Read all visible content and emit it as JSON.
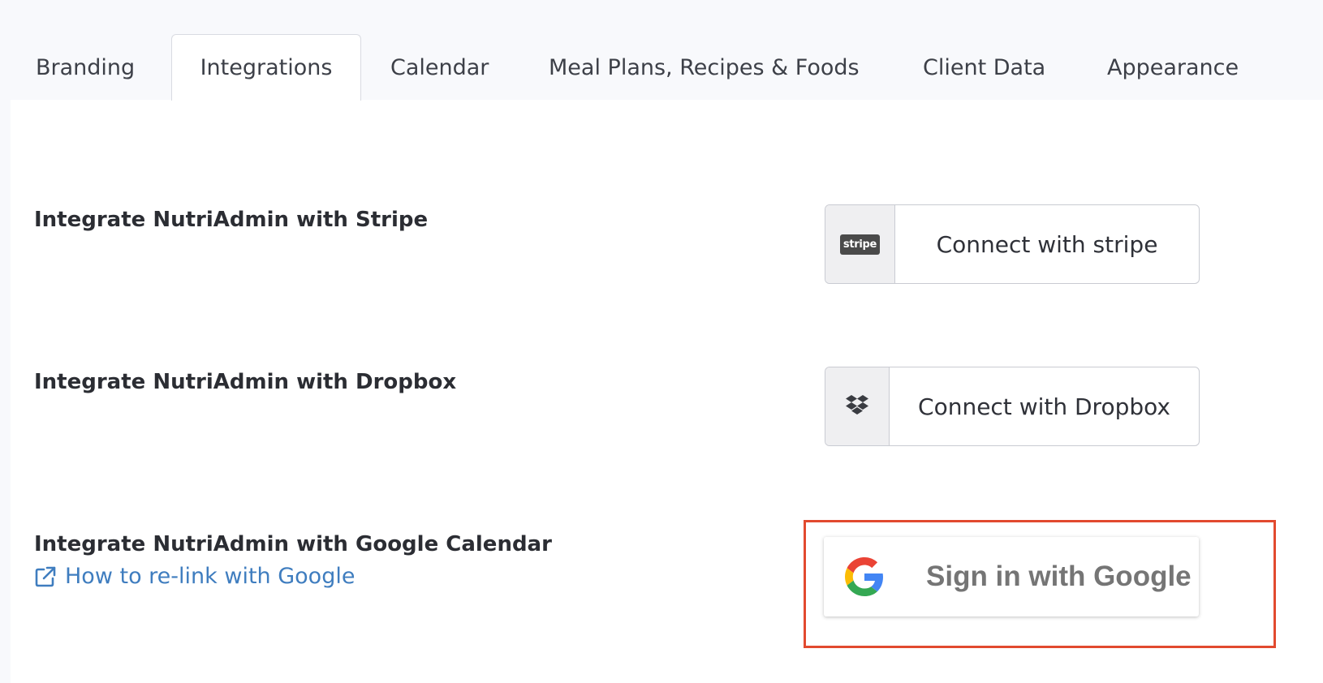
{
  "tabs": [
    {
      "label": "Branding",
      "active": false
    },
    {
      "label": "Integrations",
      "active": true
    },
    {
      "label": "Calendar",
      "active": false
    },
    {
      "label": "Meal Plans, Recipes & Foods",
      "active": false
    },
    {
      "label": "Client Data",
      "active": false
    },
    {
      "label": "Appearance",
      "active": false
    }
  ],
  "integrations": {
    "stripe": {
      "label": "Integrate NutriAdmin with Stripe",
      "button_label": "Connect with stripe",
      "icon": "stripe-logo-icon",
      "icon_text": "stripe"
    },
    "dropbox": {
      "label": "Integrate NutriAdmin with Dropbox",
      "button_label": "Connect with Dropbox",
      "icon": "dropbox-icon"
    },
    "google": {
      "label": "Integrate NutriAdmin with Google Calendar",
      "link_text": "How to re-link with Google",
      "link_icon": "external-link-icon",
      "button_label": "Sign in with Google",
      "icon": "google-g-icon"
    }
  },
  "colors": {
    "link": "#3f7dbf",
    "highlight": "#e24a2f",
    "google_blue": "#4285F4",
    "google_red": "#EA4335",
    "google_yellow": "#FBBC05",
    "google_green": "#34A853"
  }
}
